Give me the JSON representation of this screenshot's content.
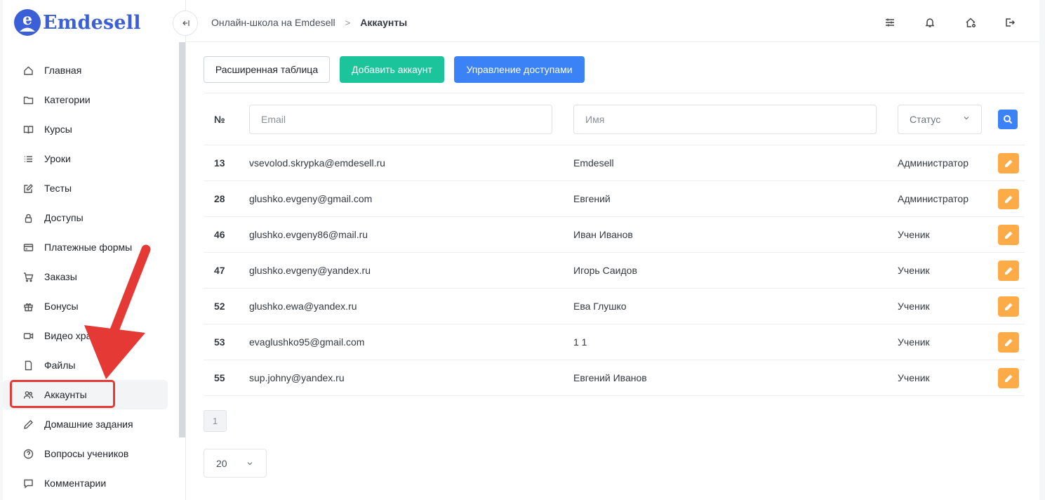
{
  "brand": {
    "name": "Emdesell"
  },
  "sidebar": {
    "items": [
      {
        "label": "Главная",
        "icon": "home-icon"
      },
      {
        "label": "Категории",
        "icon": "folder-icon"
      },
      {
        "label": "Курсы",
        "icon": "book-icon"
      },
      {
        "label": "Уроки",
        "icon": "list-icon"
      },
      {
        "label": "Тесты",
        "icon": "edit-square-icon"
      },
      {
        "label": "Доступы",
        "icon": "lock-icon"
      },
      {
        "label": "Платежные формы",
        "icon": "credit-card-icon"
      },
      {
        "label": "Заказы",
        "icon": "cart-icon"
      },
      {
        "label": "Бонусы",
        "icon": "gift-icon"
      },
      {
        "label": "Видео хранилище",
        "icon": "video-icon"
      },
      {
        "label": "Файлы",
        "icon": "file-icon"
      },
      {
        "label": "Аккаунты",
        "icon": "users-icon",
        "active": true
      },
      {
        "label": "Домашние задания",
        "icon": "pencil-icon"
      },
      {
        "label": "Вопросы учеников",
        "icon": "help-circle-icon"
      },
      {
        "label": "Комментарии",
        "icon": "message-icon"
      }
    ]
  },
  "topbar": {
    "breadcrumb": {
      "parent": "Онлайн-школа на Emdesell",
      "separator": ">",
      "current": "Аккаунты"
    },
    "icons": [
      "sliders-icon",
      "bell-icon",
      "home-settings-icon",
      "logout-icon"
    ]
  },
  "toolbar": {
    "extended_table": "Расширенная таблица",
    "add_account": "Добавить аккаунт",
    "manage_access": "Управление доступами"
  },
  "filters": {
    "num_header": "№",
    "email_placeholder": "Email",
    "name_placeholder": "Имя",
    "status_label": "Статус"
  },
  "accounts": [
    {
      "id": "13",
      "email": "vsevolod.skrypka@emdesell.ru",
      "name": "Emdesell",
      "role": "Администратор"
    },
    {
      "id": "28",
      "email": "glushko.evgeny@gmail.com",
      "name": "Евгений",
      "role": "Администратор"
    },
    {
      "id": "46",
      "email": "glushko.evgeny86@mail.ru",
      "name": "Иван Иванов",
      "role": "Ученик"
    },
    {
      "id": "47",
      "email": "glushko.evgeny@yandex.ru",
      "name": "Игорь Саидов",
      "role": "Ученик"
    },
    {
      "id": "52",
      "email": "glushko.ewa@yandex.ru",
      "name": "Ева Глушко",
      "role": "Ученик"
    },
    {
      "id": "53",
      "email": "evaglushko95@gmail.com",
      "name": "1 1",
      "role": "Ученик"
    },
    {
      "id": "55",
      "email": "sup.johny@yandex.ru",
      "name": "Евгений Иванов",
      "role": "Ученик"
    }
  ],
  "pagination": {
    "current_page": "1",
    "per_page": "20"
  },
  "colors": {
    "brand": "#3b5fd6",
    "green_button": "#1cc49b",
    "blue_button": "#3b82f6",
    "edit_button": "#fdab46",
    "annotation": "#e53935"
  }
}
